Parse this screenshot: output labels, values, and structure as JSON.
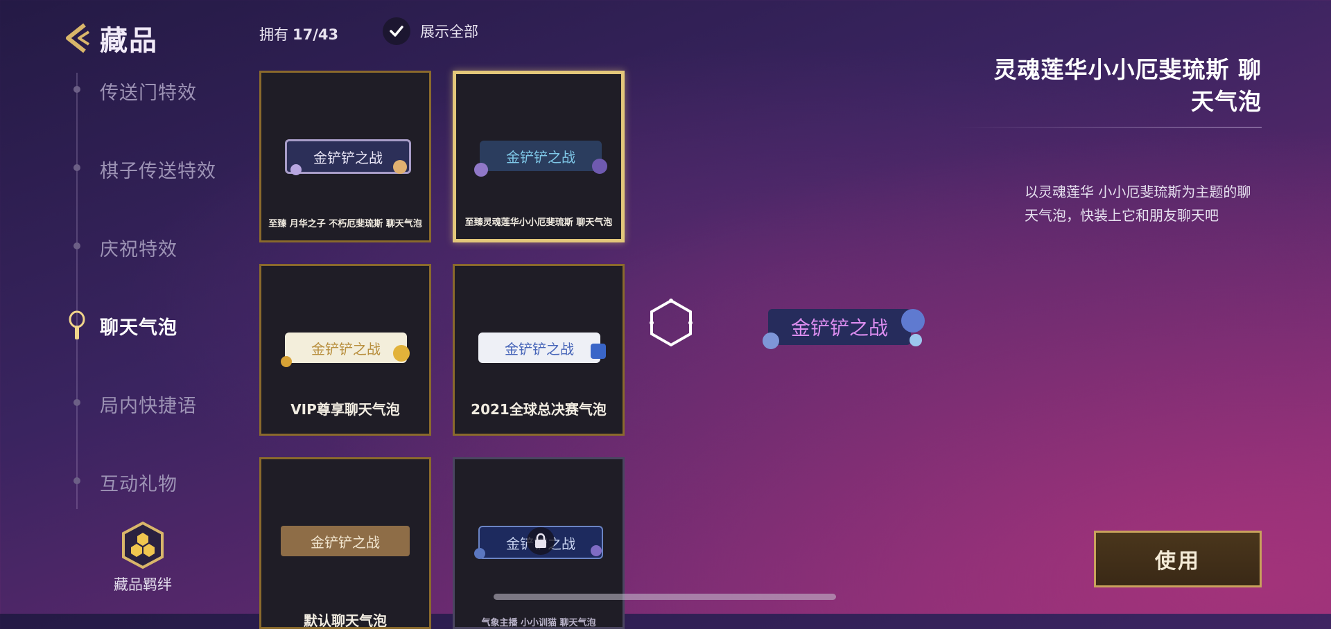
{
  "header": {
    "back_title": "藏品",
    "owned_label": "拥有",
    "owned_count": "17/43",
    "show_all_label": "展示全部",
    "show_all_checked": true
  },
  "nav": {
    "items": [
      {
        "label": "传送门特效",
        "active": false
      },
      {
        "label": "棋子传送特效",
        "active": false
      },
      {
        "label": "庆祝特效",
        "active": false
      },
      {
        "label": "聊天气泡",
        "active": true
      },
      {
        "label": "局内快捷语",
        "active": false
      },
      {
        "label": "互动礼物",
        "active": false
      }
    ],
    "bond_label": "藏品羁绊"
  },
  "cards": [
    {
      "bubble_text": "金铲铲之战",
      "name": "至臻 月华之子 不朽厄斐琉斯 聊天气泡",
      "style": "dark",
      "selected": false,
      "locked": false
    },
    {
      "bubble_text": "金铲铲之战",
      "name": "至臻灵魂莲华小小厄斐琉斯 聊天气泡",
      "style": "teal",
      "selected": true,
      "locked": false
    },
    {
      "bubble_text": "金铲铲之战",
      "name": "VIP尊享聊天气泡",
      "style": "cream",
      "selected": false,
      "locked": false
    },
    {
      "bubble_text": "金铲铲之战",
      "name": "2021全球总决赛气泡",
      "style": "white",
      "selected": false,
      "locked": false
    },
    {
      "bubble_text": "金铲铲之战",
      "name": "默认聊天气泡",
      "style": "brown",
      "selected": false,
      "locked": false
    },
    {
      "bubble_text": "金铲铲之战",
      "name": "气象主播 小小训猫 聊天气泡",
      "style": "navy",
      "selected": false,
      "locked": true
    }
  ],
  "preview": {
    "bubble_text": "金铲铲之战"
  },
  "detail": {
    "title": "灵魂莲华小小厄斐琉斯 聊天气泡",
    "description": "以灵魂莲华 小小厄斐琉斯为主题的聊天气泡，快装上它和朋友聊天吧",
    "use_button": "使用"
  },
  "colors": {
    "gold_border": "#8a6a2c",
    "selected_border": "#e3c77a",
    "accent_purple": "#dd8ef0"
  }
}
